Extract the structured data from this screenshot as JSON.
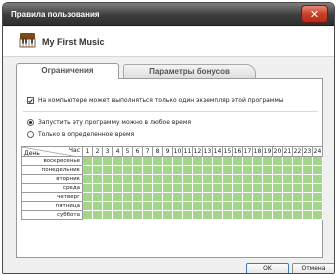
{
  "window": {
    "title": "Правила пользования",
    "close_symbol": "✕"
  },
  "app": {
    "name": "My First Music",
    "icon": "piano-icon"
  },
  "tabs": [
    {
      "label": "Ограничения",
      "active": true
    },
    {
      "label": "Параметры бонусов",
      "active": false
    }
  ],
  "options": {
    "single_instance": {
      "label": "На компьютере может выполняться только один экземпляр этой программы",
      "checked": true
    },
    "run_any_time": {
      "label": "Запустить эту программу можно в любое время",
      "selected": true
    },
    "run_specific_time": {
      "label": "Только в определенное время",
      "selected": false
    }
  },
  "schedule": {
    "day_header": "День",
    "hour_header": "Час",
    "hours": [
      "1",
      "2",
      "3",
      "4",
      "5",
      "6",
      "7",
      "8",
      "9",
      "10",
      "11",
      "12",
      "13",
      "14",
      "15",
      "16",
      "17",
      "18",
      "19",
      "20",
      "21",
      "22",
      "23",
      "24"
    ],
    "days": [
      "воскресенье",
      "понедельник",
      "вторник",
      "среда",
      "четверг",
      "пятница",
      "суббота"
    ],
    "allowed_color": "#a3d58a"
  },
  "buttons": {
    "ok": "OK",
    "cancel": "Отмена"
  }
}
